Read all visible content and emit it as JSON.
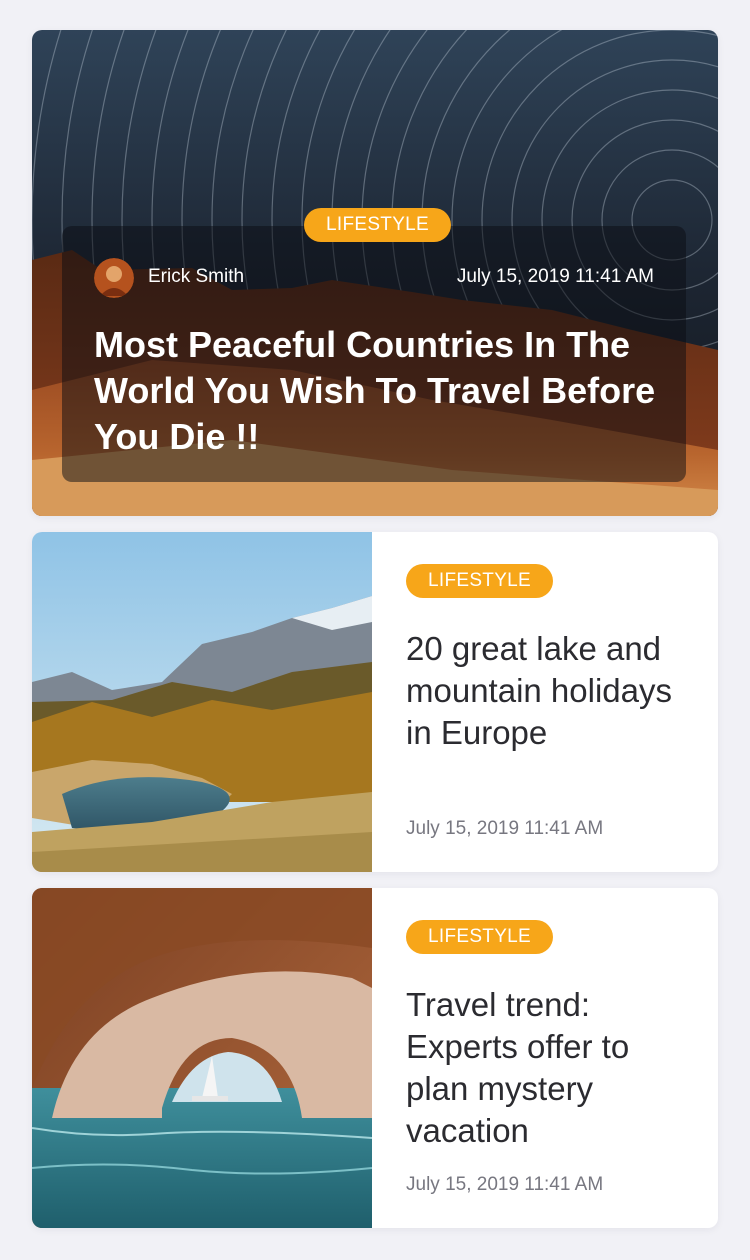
{
  "featured": {
    "category": "LIFESTYLE",
    "author": "Erick Smith",
    "date": "July 15, 2019 11:41 AM",
    "title": "Most Peaceful Countries In The World You Wish To Travel Before You Die !!"
  },
  "articles": [
    {
      "category": "LIFESTYLE",
      "title": "20 great lake and mountain holidays in Europe",
      "date": "July 15, 2019 11:41 AM"
    },
    {
      "category": "LIFESTYLE",
      "title": "Travel trend: Experts offer to plan mystery vacation",
      "date": "July 15, 2019 11:41 AM"
    }
  ],
  "colors": {
    "accent": "#f7a619",
    "background": "#f1f1f6",
    "card": "#ffffff",
    "title_text": "#2b2b30",
    "meta_text": "#777780"
  }
}
